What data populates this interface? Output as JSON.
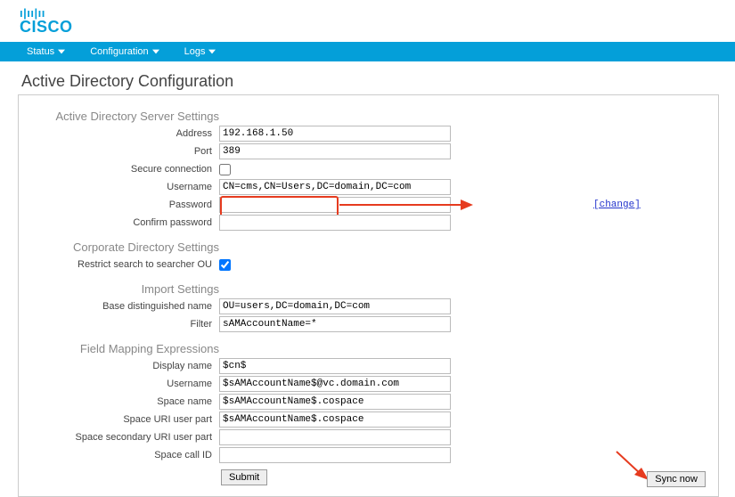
{
  "nav": {
    "items": [
      "Status",
      "Configuration",
      "Logs"
    ]
  },
  "page_title": "Active Directory Configuration",
  "sections": {
    "server": {
      "title": "Active Directory Server Settings",
      "address_label": "Address",
      "address_value": "192.168.1.50",
      "port_label": "Port",
      "port_value": "389",
      "secure_label": "Secure connection",
      "secure_value": false,
      "username_label": "Username",
      "username_value": "CN=cms,CN=Users,DC=domain,DC=com",
      "password_label": "Password",
      "confirm_label": "Confirm password",
      "change_link": "[change]"
    },
    "corp": {
      "title": "Corporate Directory Settings",
      "restrict_label": "Restrict search to searcher OU",
      "restrict_value": true
    },
    "import": {
      "title": "Import Settings",
      "basedn_label": "Base distinguished name",
      "basedn_value": "OU=users,DC=domain,DC=com",
      "filter_label": "Filter",
      "filter_value": "sAMAccountName=*"
    },
    "mapping": {
      "title": "Field Mapping Expressions",
      "display_label": "Display name",
      "display_value": "$cn$",
      "username_label": "Username",
      "username_value": "$sAMAccountName$@vc.domain.com",
      "spacename_label": "Space name",
      "spacename_value": "$sAMAccountName$.cospace",
      "spaceuri_label": "Space URI user part",
      "spaceuri_value": "$sAMAccountName$.cospace",
      "spaceuri2_label": "Space secondary URI user part",
      "spaceuri2_value": "",
      "callid_label": "Space call ID",
      "callid_value": ""
    }
  },
  "buttons": {
    "submit": "Submit",
    "sync": "Sync now"
  }
}
